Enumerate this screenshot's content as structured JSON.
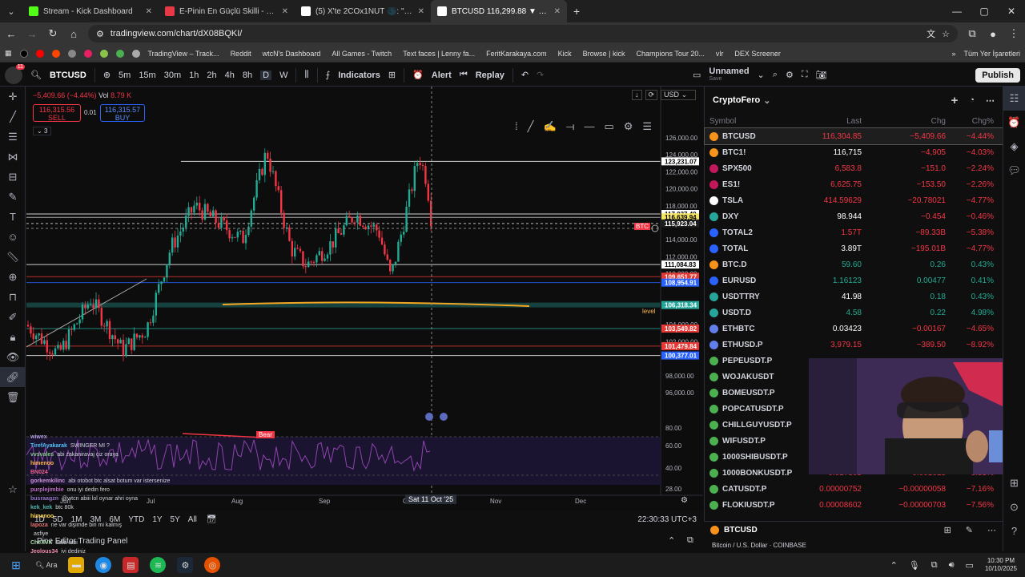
{
  "browser": {
    "tabs": [
      {
        "label": "Stream - Kick Dashboard",
        "icon": "kick-icon",
        "color": "#53fc18"
      },
      {
        "label": "E-Pinin En Güçlü Skilli - Pindirin",
        "icon": "epin-icon",
        "color": "#e63946"
      },
      {
        "label": "(5) X'te 2COx1NUT 🌑: \"Wo0t",
        "icon": "x-icon",
        "color": "#ffffff"
      },
      {
        "label": "BTCUSD 116,299.88 ▼ −4.45%",
        "icon": "tradingview-icon",
        "color": "#ffffff"
      }
    ],
    "url": "tradingview.com/chart/dX08BQKI/",
    "bookmarks": [
      "TradingView – Track...",
      "Reddit",
      "wtcN's Dashboard",
      "All Games - Twitch",
      "Text faces | Lenny fa...",
      "FeritKarakaya.com",
      "Kick",
      "Browse | kick",
      "Champions Tour 20...",
      "vlr",
      "DEX Screener"
    ],
    "bookmarks_right": "Tüm Yer İşaretleri"
  },
  "tv": {
    "symbol": "BTCUSD",
    "intervals": [
      "5m",
      "15m",
      "30m",
      "1h",
      "2h",
      "4h",
      "8h",
      "D",
      "W"
    ],
    "indicators": "Indicators",
    "alert": "Alert",
    "replay": "Replay",
    "layout_name": "Unnamed",
    "layout_sub": "Save",
    "publish": "Publish"
  },
  "chart": {
    "change": "−5,409.66 (−4.44%)",
    "vol": "Vol",
    "vol_val": "8.79 K",
    "sell_price": "116,315.56",
    "sell_label": "SELL",
    "spread": "0.01",
    "buy_price": "116,315.57",
    "buy_label": "BUY",
    "collapse_count": "3",
    "currency": "USD",
    "price_ticks": [
      "126,000.00",
      "124,000.00",
      "122,000.00",
      "120,000.00",
      "118,000.00",
      "114,000.00",
      "112,000.00",
      "110,000.00",
      "104,000.00",
      "102,000.00",
      "98,000.00",
      "96,000.00"
    ],
    "price_labels": [
      {
        "v": "123,231.07",
        "bg": "#ffffff",
        "fg": "#000000"
      },
      {
        "v": "117,037.40",
        "bg": "#ffffff",
        "fg": "#000000"
      },
      {
        "v": "116,639.94",
        "bg": "#f5e663",
        "fg": "#000000"
      },
      {
        "v": "115,923.04",
        "bg": "#1e1e1e",
        "fg": "#ffffff"
      },
      {
        "v": "111,084.83",
        "bg": "#ffffff",
        "fg": "#000000"
      },
      {
        "v": "109,651.77",
        "bg": "#e53935",
        "fg": "#ffffff"
      },
      {
        "v": "108,954.91",
        "bg": "#2962ff",
        "fg": "#ffffff"
      },
      {
        "v": "106,318.34",
        "bg": "#26a69a",
        "fg": "#ffffff"
      },
      {
        "v": "103,549.82",
        "bg": "#e53935",
        "fg": "#ffffff"
      },
      {
        "v": "101,479.84",
        "bg": "#e53935",
        "fg": "#ffffff"
      },
      {
        "v": "100,377.01",
        "bg": "#2962ff",
        "fg": "#ffffff"
      }
    ],
    "btc_tag": "BTC",
    "level_label": "level",
    "bear_label": "Bear",
    "rsi_ticks": [
      "80.00",
      "60.00",
      "40.00",
      "28.00"
    ],
    "time_labels": [
      "Jun",
      "Jul",
      "Aug",
      "Sep",
      "Oct",
      "Nov",
      "Dec"
    ],
    "crosshair_time": "Sat 11 Oct '25",
    "ranges": [
      "1D",
      "5D",
      "1M",
      "3M",
      "6M",
      "YTD",
      "1Y",
      "5Y",
      "All"
    ],
    "clock": "22:30:33 UTC+3",
    "panels": "Pine Editor    Trading Panel"
  },
  "watchlist": {
    "title": "CryptoFero",
    "columns": [
      "Symbol",
      "Last",
      "Chg",
      "Chg%"
    ],
    "rows": [
      {
        "s": "BTCUSD",
        "l": "116,304.85",
        "c": "−5,409.66",
        "p": "−4.44%",
        "dir": "down",
        "icon": "#f7931a"
      },
      {
        "s": "BTC1!",
        "l": "116,715",
        "c": "−4,905",
        "p": "−4.03%",
        "dir": "down",
        "icon": "#f7931a"
      },
      {
        "s": "SPX500",
        "l": "6,583.8",
        "c": "−151.0",
        "p": "−2.24%",
        "dir": "down",
        "icon": "#c2185b"
      },
      {
        "s": "ES1!",
        "l": "6,625.75",
        "c": "−153.50",
        "p": "−2.26%",
        "dir": "down",
        "icon": "#c2185b"
      },
      {
        "s": "TSLA",
        "l": "414.59629",
        "c": "−20.78021",
        "p": "−4.77%",
        "dir": "down",
        "icon": "#ffffff"
      },
      {
        "s": "DXY",
        "l": "98.944",
        "c": "−0.454",
        "p": "−0.46%",
        "dir": "down",
        "icon": "#26a69a"
      },
      {
        "s": "TOTAL2",
        "l": "1.57T",
        "c": "−89.33B",
        "p": "−5.38%",
        "dir": "down",
        "icon": "#2962ff"
      },
      {
        "s": "TOTAL",
        "l": "3.89T",
        "c": "−195.01B",
        "p": "−4.77%",
        "dir": "down",
        "icon": "#2962ff"
      },
      {
        "s": "BTC.D",
        "l": "59.60",
        "c": "0.26",
        "p": "0.43%",
        "dir": "up",
        "icon": "#f7931a"
      },
      {
        "s": "EURUSD",
        "l": "1.16123",
        "c": "0.00477",
        "p": "0.41%",
        "dir": "up",
        "icon": "#2962ff"
      },
      {
        "s": "USDTTRY",
        "l": "41.98",
        "c": "0.18",
        "p": "0.43%",
        "dir": "up",
        "icon": "#26a69a"
      },
      {
        "s": "USDT.D",
        "l": "4.58",
        "c": "0.22",
        "p": "4.98%",
        "dir": "up",
        "icon": "#26a69a"
      },
      {
        "s": "ETHBTC",
        "l": "0.03423",
        "c": "−0.00167",
        "p": "−4.65%",
        "dir": "down",
        "icon": "#627eea"
      },
      {
        "s": "ETHUSD.P",
        "l": "3,979.15",
        "c": "−389.50",
        "p": "−8.92%",
        "dir": "down",
        "icon": "#627eea"
      },
      {
        "s": "PEPEUSDT.P",
        "l": "",
        "c": "",
        "p": "",
        "dir": "down",
        "icon": "#4caf50"
      },
      {
        "s": "WOJAKUSDT",
        "l": "",
        "c": "",
        "p": "",
        "dir": "down",
        "icon": "#4caf50"
      },
      {
        "s": "BOMEUSDT.P",
        "l": "",
        "c": "",
        "p": "",
        "dir": "down",
        "icon": "#4caf50"
      },
      {
        "s": "POPCATUSDT.P",
        "l": "",
        "c": "",
        "p": "",
        "dir": "down",
        "icon": "#4caf50"
      },
      {
        "s": "CHILLGUYUSDT.P",
        "l": "",
        "c": "",
        "p": "",
        "dir": "down",
        "icon": "#4caf50"
      },
      {
        "s": "WIFUSDT.P",
        "l": "",
        "c": "",
        "p": "",
        "dir": "down",
        "icon": "#4caf50"
      },
      {
        "s": "1000SHIBUSDT.P",
        "l": "",
        "c": "",
        "p": "",
        "dir": "down",
        "icon": "#4caf50"
      },
      {
        "s": "1000BONKUSDT.P",
        "l": "0.017305",
        "c": "−0.001613",
        "p": "−8.53%",
        "dir": "down",
        "icon": "#4caf50"
      },
      {
        "s": "CATUSDT.P",
        "l": "0.00000752",
        "c": "−0.00000058",
        "p": "−7.16%",
        "dir": "down",
        "icon": "#4caf50"
      },
      {
        "s": "FLOKIUSDT.P",
        "l": "0.00008602",
        "c": "−0.00000703",
        "p": "−7.56%",
        "dir": "down",
        "icon": "#4caf50"
      }
    ],
    "footer_symbol": "BTCUSD",
    "footer_desc": "Bitcoin / U.S. Dollar · COINBASE"
  },
  "chat": [
    {
      "u": "wiwex",
      "m": ""
    },
    {
      "u": "TirefAyakarak",
      "m": "SWINGER MI ?"
    },
    {
      "u": "vvsvales",
      "m": "abi zakaniravaj çiz oraya"
    },
    {
      "u": "himenoo",
      "m": ""
    },
    {
      "u": "BN024",
      "m": ""
    },
    {
      "u": "gorkemkilinc",
      "m": "abi otobot btc alsat botum var istersenize"
    },
    {
      "u": "purplejimbie",
      "m": "onu iyi dedin fero"
    },
    {
      "u": "busraagzn",
      "m": "@wtcn abiii lol oynar ahri oyna"
    },
    {
      "u": "kek_kek",
      "m": "btc 80k"
    },
    {
      "u": "himenoo",
      "m": ""
    },
    {
      "u": "lapoza",
      "m": "ne var dişimde biri mi kalmış"
    },
    {
      "u": "",
      "m": "asfiye"
    },
    {
      "u": "CheXVX",
      "m": "salla tabi"
    },
    {
      "u": "Jeolous34",
      "m": "iyi dediniz"
    }
  ],
  "taskbar": {
    "search": "Ara",
    "time": "10:30 PM",
    "date": "10/10/2025"
  },
  "colors": {
    "green": "#22ab94",
    "red": "#f23645",
    "accent": "#2962ff"
  }
}
